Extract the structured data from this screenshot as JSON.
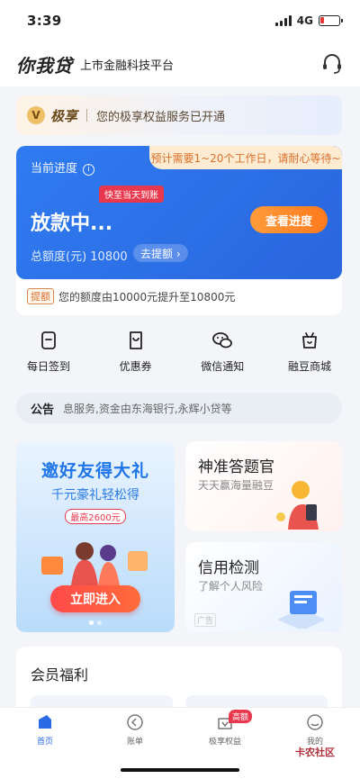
{
  "status_bar": {
    "time": "3:39",
    "network": "4G"
  },
  "header": {
    "logo": "你我贷",
    "subtitle": "上市金融科技平台",
    "cs_icon": "headset-icon"
  },
  "vip": {
    "badge": "V",
    "name": "极享",
    "text": "您的极享权益服务已开通"
  },
  "progress": {
    "label": "当前进度",
    "tip": "预计需要1~20个工作日，请耐心等待~",
    "fast_tag": "快至当天到账",
    "status": "放款中...",
    "button": "查看进度",
    "amount_text": "总额度(元) 10800",
    "withdraw": "去提额 ›",
    "raise_tag": "提额",
    "raise_text": "您的额度由10000元提升至10800元"
  },
  "quick_actions": [
    {
      "label": "每日签到",
      "icon": "checkin-icon"
    },
    {
      "label": "优惠券",
      "icon": "coupon-icon"
    },
    {
      "label": "微信通知",
      "icon": "wechat-icon"
    },
    {
      "label": "融豆商城",
      "icon": "mall-icon"
    }
  ],
  "notice": {
    "label": "公告",
    "text": "息服务,资金由东海银行,永辉小贷等"
  },
  "invite": {
    "title": "邀好友得大礼",
    "subtitle": "千元豪礼轻松得",
    "tag": "最高2600元",
    "button": "立即进入"
  },
  "quiz": {
    "title": "神准答题官",
    "subtitle": "天天赢海量融豆"
  },
  "credit": {
    "title": "信用检测",
    "subtitle": "了解个人风险",
    "ad": "广告"
  },
  "member": {
    "title": "会员福利"
  },
  "tabbar": {
    "items": [
      {
        "label": "首页",
        "icon": "home-icon",
        "active": true
      },
      {
        "label": "账单",
        "icon": "bill-icon"
      },
      {
        "label": "极享权益",
        "icon": "vip-benefit-icon",
        "badge": "高额"
      },
      {
        "label": "我的",
        "icon": "profile-icon"
      }
    ],
    "watermark": "卡农社区"
  },
  "colors": {
    "primary": "#2a6be5",
    "accent_orange": "#ff7a1e",
    "badge_red": "#e8384d"
  }
}
